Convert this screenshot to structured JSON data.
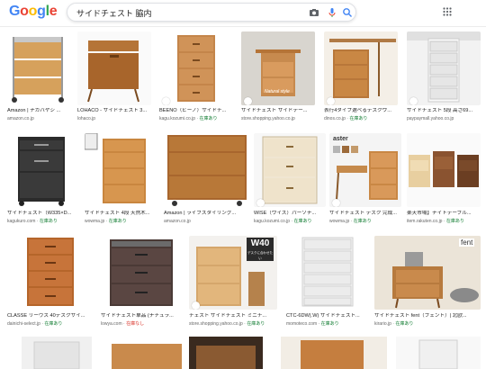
{
  "header": {
    "logo_letters": [
      "G",
      "o",
      "o",
      "g",
      "l",
      "e"
    ],
    "logo_colors": [
      "#4285F4",
      "#EA4335",
      "#FBBC05",
      "#4285F4",
      "#34A853",
      "#EA4335"
    ],
    "query": "サイドチェスト 脇内"
  },
  "results": [
    {
      "title": "Amazon | ナカバヤシ ...",
      "source": "amazon.co.jp",
      "stock": ""
    },
    {
      "title": "LOHACO - サイドチェスト 3...",
      "source": "lohaco.jp",
      "stock": ""
    },
    {
      "title": "BEENO（ビーノ）サイドチ...",
      "source": "kagu.kozumi.co.jp",
      "stock": "在庫あり"
    },
    {
      "title": "サイドチェスト サイドテー...",
      "source": "store.shopping.yahoo.co.jp",
      "stock": ""
    },
    {
      "title": "表行4タイプ選べるデスクワ...",
      "source": "dinos.co.jp",
      "stock": "在庫あり"
    },
    {
      "title": "サイドチェスト 5段 高さ69...",
      "source": "paypaymall.yahoo.co.jp",
      "stock": ""
    },
    {
      "title": "サイドチェスト（W335×D...",
      "source": "kagukuro.com",
      "stock": "在庫あり"
    },
    {
      "title": "サイドチェスト 4段 天然木...",
      "source": "wowma.jp",
      "stock": "在庫あり"
    },
    {
      "title": "Amazon | ライフスタイリング...",
      "source": "amazon.co.jp",
      "stock": ""
    },
    {
      "title": "WISE（ワイズ）パーソナ...",
      "source": "kagu.kozumi.co.jp",
      "stock": "在庫あり"
    },
    {
      "title": "サイドチェスト デスク 完成...",
      "source": "wowma.jp",
      "stock": "在庫あり"
    },
    {
      "title": "楽天市場】ナイトテーブル...",
      "source": "item.rakuten.co.jp",
      "stock": "在庫あり"
    },
    {
      "title": "CLASSE リーヴス 40デスクサイ...",
      "source": "dainichi-select.jp",
      "stock": "在庫あり"
    },
    {
      "title": "サイドチェスト単品 (ナチュラ...",
      "source": "lowya.com",
      "stock": "在庫なし"
    },
    {
      "title": "チェスト サイドチェスト ミニチ...",
      "source": "store.shopping.yahoo.co.jp",
      "stock": "在庫あり"
    },
    {
      "title": "CTC-6DW(.W) サイドチェスト...",
      "source": "momoteco.com",
      "stock": "在庫あり"
    },
    {
      "title": "サイドチェスト fent（フェント）| 北欧...",
      "source": "kirario.jp",
      "stock": "在庫あり"
    }
  ],
  "overlays": {
    "w40": "W40",
    "w40_sub": "デスクに合わせたい",
    "aster": "aster",
    "fent": "fent",
    "natural": "Natural style"
  },
  "colors": {
    "stock": "#188038",
    "out_of_stock": "#d93025",
    "link": "#1a73e8"
  }
}
